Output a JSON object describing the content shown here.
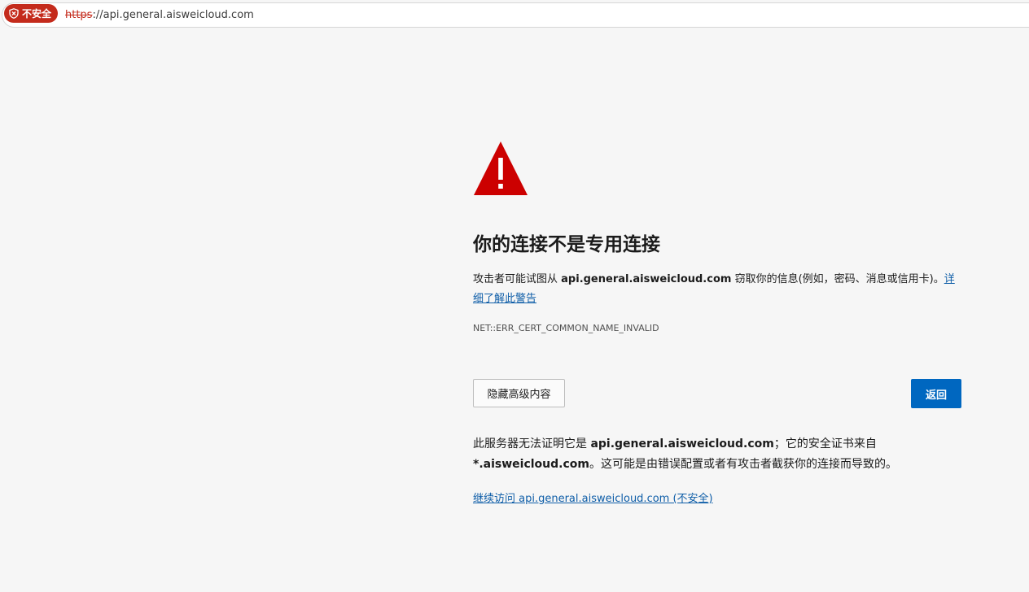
{
  "address_bar": {
    "security_badge": "不安全",
    "security_icon": "shield-icon",
    "url_scheme": "https",
    "url_rest": "://api.general.aisweicloud.com",
    "badge_color": "#c42b1c"
  },
  "main": {
    "warning_icon": "warning-triangle-icon",
    "warning_color": "#cc0000",
    "title": "你的连接不是专用连接",
    "description": {
      "prefix": "攻击者可能试图从",
      "host": "api.general.aisweicloud.com",
      "suffix": "窃取你的信息(例如，密码、消息或信用卡)。",
      "learn_more": "详细了解此警告"
    },
    "error_code": "NET::ERR_CERT_COMMON_NAME_INVALID",
    "advanced_button": "隐藏高级内容",
    "back_button": "返回",
    "back_button_color": "#0067c0",
    "details": {
      "prefix": "此服务器无法证明它是",
      "host": "api.general.aisweicloud.com",
      "middle": "；它的安全证书来自",
      "cert_domain": "*.aisweicloud.com",
      "suffix": "。这可能是由错误配置或者有攻击者截获你的连接而导致的。"
    },
    "proceed_link": "继续访问 api.general.aisweicloud.com (不安全)"
  }
}
